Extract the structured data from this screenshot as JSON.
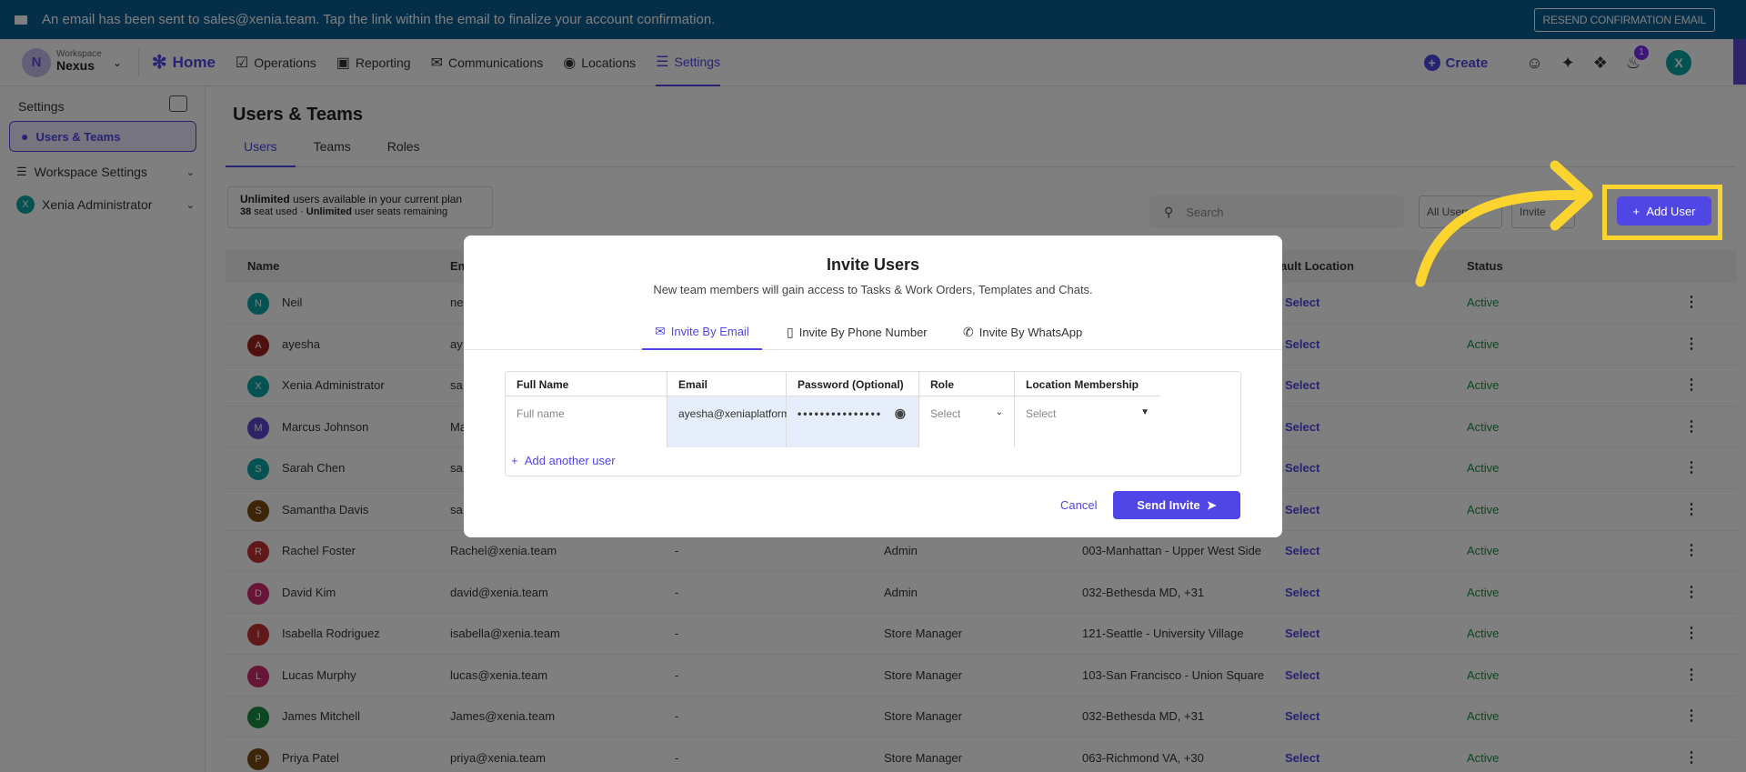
{
  "banner": {
    "text": "An email has been sent to sales@xenia.team. Tap the link within the email to finalize your account confirmation.",
    "resend": "RESEND CONFIRMATION EMAIL"
  },
  "workspace": {
    "avatar": "N",
    "label": "Workspace",
    "name": "Nexus"
  },
  "nav": {
    "home": "Home",
    "items": [
      "Operations",
      "Reporting",
      "Communications",
      "Locations",
      "Settings"
    ]
  },
  "topright": {
    "create": "Create",
    "notif_count": "1",
    "user": "X"
  },
  "sidebar": {
    "title": "Settings",
    "selected": "Users & Teams",
    "items": [
      "Workspace Settings",
      "Xenia Administrator"
    ],
    "admin_avatar": "X"
  },
  "page": {
    "title": "Users & Teams",
    "tabs": [
      "Users",
      "Teams",
      "Roles"
    ],
    "plan": {
      "bold": "Unlimited",
      "rest": " users available in your current plan",
      "seat_count": "38",
      "seat_text": " seat used · ",
      "seat_bold": "Unlimited",
      "seat_rest": " user seats remaining"
    },
    "search_placeholder": "Search",
    "filter": "All Users",
    "import": "Invite",
    "add_user": "Add User"
  },
  "table": {
    "headers": [
      "Name",
      "Em",
      "ault Location",
      "Status"
    ],
    "rows": [
      {
        "initial": "N",
        "color": "#0aa5a7",
        "name": "Neil",
        "email": "ne",
        "role": "",
        "loc": "",
        "select": "Select",
        "status": "Active"
      },
      {
        "initial": "A",
        "color": "#a02020",
        "name": "ayesha",
        "email": "ay",
        "role": "",
        "loc": "",
        "select": "Select",
        "status": "Active"
      },
      {
        "initial": "X",
        "color": "#0aa5a7",
        "name": "Xenia Administrator",
        "email": "sa",
        "role": "",
        "loc": "",
        "select": "Select",
        "status": "Active"
      },
      {
        "initial": "M",
        "color": "#5b4bd1",
        "name": "Marcus Johnson",
        "email": "Ma",
        "role": "",
        "loc": "",
        "select": "Select",
        "status": "Active"
      },
      {
        "initial": "S",
        "color": "#0aa5a7",
        "name": "Sarah Chen",
        "email": "sa",
        "role": "",
        "loc": "",
        "select": "Select",
        "status": "Active"
      },
      {
        "initial": "S",
        "color": "#7a4a10",
        "name": "Samantha Davis",
        "email": "sa",
        "role": "",
        "loc": "",
        "select": "Select",
        "status": "Active"
      },
      {
        "initial": "R",
        "color": "#c03030",
        "name": "Rachel Foster",
        "email": "Rachel@xenia.team",
        "dash": "-",
        "role": "Admin",
        "loc": "003-Manhattan - Upper West Side",
        "select": "Select",
        "status": "Active"
      },
      {
        "initial": "D",
        "color": "#d02b6e",
        "name": "David Kim",
        "email": "david@xenia.team",
        "dash": "-",
        "role": "Admin",
        "loc": "032-Bethesda MD, +31",
        "select": "Select",
        "status": "Active"
      },
      {
        "initial": "I",
        "color": "#c03030",
        "name": "Isabella Rodriguez",
        "email": "isabella@xenia.team",
        "dash": "-",
        "role": "Store Manager",
        "loc": "121-Seattle - University Village",
        "select": "Select",
        "status": "Active"
      },
      {
        "initial": "L",
        "color": "#d02b6e",
        "name": "Lucas Murphy",
        "email": "lucas@xenia.team",
        "dash": "-",
        "role": "Store Manager",
        "loc": "103-San Francisco - Union Square",
        "select": "Select",
        "status": "Active"
      },
      {
        "initial": "J",
        "color": "#1a8f42",
        "name": "James Mitchell",
        "email": "James@xenia.team",
        "dash": "-",
        "role": "Store Manager",
        "loc": "032-Bethesda MD, +31",
        "select": "Select",
        "status": "Active"
      },
      {
        "initial": "P",
        "color": "#7a4a10",
        "name": "Priya Patel",
        "email": "priya@xenia.team",
        "dash": "-",
        "role": "Store Manager",
        "loc": "063-Richmond VA, +30",
        "select": "Select",
        "status": "Active"
      }
    ]
  },
  "modal": {
    "title": "Invite Users",
    "subtitle": "New team members will gain access to Tasks & Work Orders, Templates and Chats.",
    "tabs": [
      "Invite By Email",
      "Invite By Phone Number",
      "Invite By WhatsApp"
    ],
    "headers": [
      "Full Name",
      "Email",
      "Password (Optional)",
      "Role",
      "Location Membership"
    ],
    "fullname_placeholder": "Full name",
    "email_value": "ayesha@xeniaplatform.ic",
    "password_value": "•••••••••••••••",
    "role_placeholder": "Select",
    "location_placeholder": "Select",
    "add_another": "Add another user",
    "cancel": "Cancel",
    "send": "Send Invite"
  }
}
